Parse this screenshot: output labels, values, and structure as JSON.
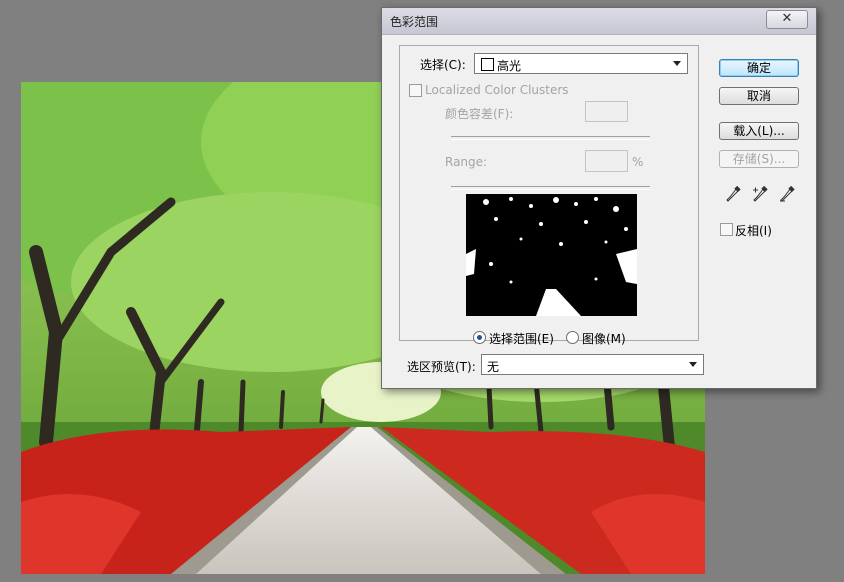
{
  "dialog": {
    "title": "色彩范围",
    "close_label": "✕",
    "select_label": "选择(C):",
    "select_value": "高光",
    "localized_label": "Localized Color Clusters",
    "fuzziness_label": "颜色容差(F):",
    "fuzziness_value": "",
    "range_label": "Range:",
    "range_value": "",
    "range_unit": "%",
    "radio_selection_label": "选择范围(E)",
    "radio_image_label": "图像(M)",
    "preview_label": "选区预览(T):",
    "preview_value": "无",
    "ok_label": "确定",
    "cancel_label": "取消",
    "load_label": "载入(L)...",
    "save_label": "存储(S)...",
    "invert_label": "反相(I)",
    "eyedroppers": [
      "eyedropper-icon",
      "eyedropper-plus-icon",
      "eyedropper-minus-icon"
    ]
  },
  "colors": {
    "workspace": "#808080",
    "dialog_bg": "#f0f0f0",
    "default_button": "#bee6fd",
    "foliage": "#7fc04a",
    "flowers": "#d0261b"
  }
}
